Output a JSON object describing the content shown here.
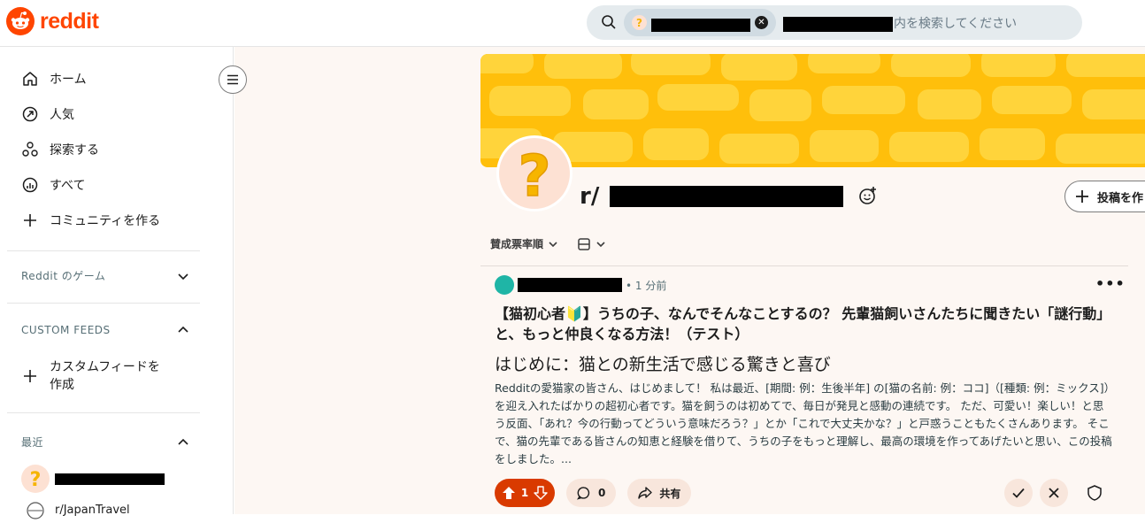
{
  "header": {
    "logo_text": "reddit",
    "search": {
      "chip_icon": "question-mark-icon",
      "placeholder_tail": "内を検索してください"
    }
  },
  "sidebar": {
    "items": [
      {
        "label": "ホーム",
        "icon": "home-icon"
      },
      {
        "label": "人気",
        "icon": "popular-icon"
      },
      {
        "label": "探索する",
        "icon": "explore-icon"
      },
      {
        "label": "すべて",
        "icon": "all-icon"
      },
      {
        "label": "コミュニティを作る",
        "icon": "plus-icon"
      }
    ],
    "games_label": "Reddit のゲーム",
    "custom_feeds_label": "CUSTOM FEEDS",
    "create_feed_label": "カスタムフィードを\n作成",
    "recent_label": "最近",
    "recent_items": [
      "r/JapanTravel"
    ]
  },
  "subreddit": {
    "prefix": "r/",
    "create_post_label": "投稿を作",
    "sort_label": "賛成票率順"
  },
  "post": {
    "time": "• 1 分前",
    "title": "【猫初心者🔰】うちの子、なんでそんなことするの？ 先輩猫飼いさんたちに聞きたい「謎行動」と、もっと仲良くなる方法！（テスト）",
    "heading": "はじめに：猫との新生活で感じる驚きと喜び",
    "body": "Redditの愛猫家の皆さん、はじめまして！ 私は最近、[期間: 例：生後半年] の[猫の名前: 例：ココ]（[種類: 例：ミックス]）を迎え入れたばかりの超初心者です。猫を飼うのは初めてで、毎日が発見と感動の連続です。 ただ、可愛い！楽しい！と思う反面、「あれ？今の行動ってどういう意味だろう？」とか「これで大丈夫かな？」と戸惑うこともたくさんあります。 そこで、猫の先輩である皆さんの知恵と経験を借りて、うちの子をもっと理解し、最高の環境を作ってあげたいと思い、この投稿をしました。...",
    "votes": "1",
    "comments": "0",
    "share_label": "共有"
  },
  "colors": {
    "brand": "#ff4500",
    "banner": "#ffbf0b",
    "vote_active": "#d93a00"
  }
}
